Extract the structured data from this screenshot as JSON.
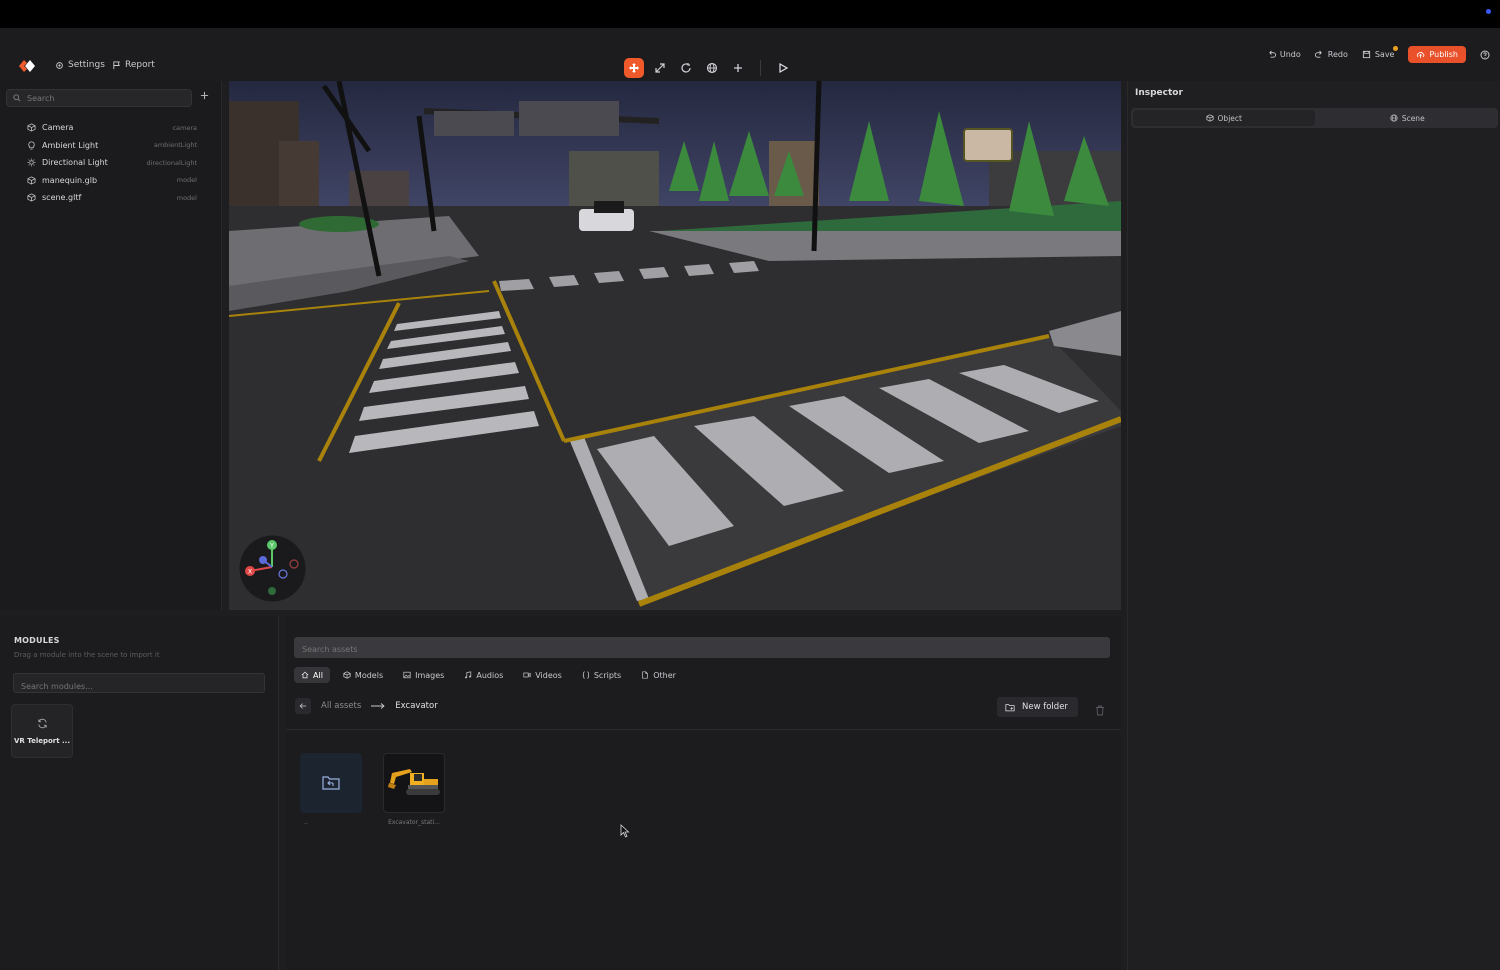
{
  "header": {
    "settings_label": "Settings",
    "report_label": "Report",
    "undo_label": "Undo",
    "redo_label": "Redo",
    "save_label": "Save",
    "publish_label": "Publish"
  },
  "scene": {
    "search_placeholder": "Search",
    "items": [
      {
        "label": "Camera",
        "type": "camera",
        "icon": "cube-icon"
      },
      {
        "label": "Ambient Light",
        "type": "ambientLight",
        "icon": "bulb-icon"
      },
      {
        "label": "Directional Light",
        "type": "directionalLight",
        "icon": "sun-icon"
      },
      {
        "label": "manequin.glb",
        "type": "model",
        "icon": "cube-icon"
      },
      {
        "label": "scene.gltf",
        "type": "model",
        "icon": "cube-icon"
      }
    ]
  },
  "inspector": {
    "title": "Inspector",
    "tabs": [
      "Object",
      "Scene"
    ],
    "active_tab": "Object"
  },
  "gizmo": {
    "axis_y": "Y",
    "axis_x": "X"
  },
  "modules": {
    "title": "MODULES",
    "subtitle": "Drag a module into the scene to import it",
    "search_placeholder": "Search modules...",
    "items": [
      {
        "label": "VR Teleport ...",
        "icon": "refresh-icon"
      }
    ]
  },
  "assets": {
    "search_placeholder": "Search assets",
    "filters": [
      "All",
      "Models",
      "Images",
      "Audios",
      "Videos",
      "Scripts",
      "Other"
    ],
    "active_filter": "All",
    "breadcrumb_root": "All assets",
    "breadcrumb_current": "Excavator",
    "new_folder_label": "New folder",
    "items": [
      {
        "label": "..",
        "kind": "folder-up"
      },
      {
        "label": "Excavator_stati...",
        "kind": "model-thumbnail"
      }
    ]
  },
  "colors": {
    "accent": "#e8512a",
    "background": "#1e1e20",
    "panel": "#1b1b1d"
  }
}
